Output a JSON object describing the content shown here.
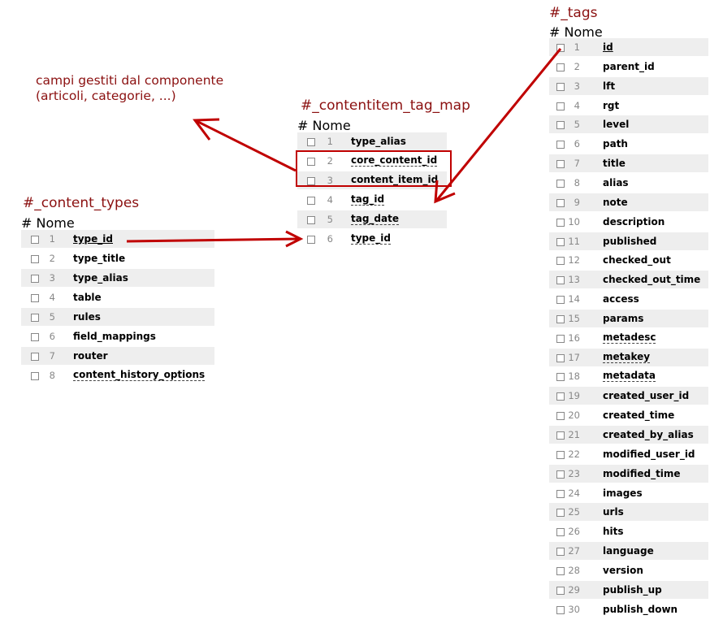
{
  "note": {
    "line1": "campi gestiti dal componente",
    "line2": "(articoli, categorie, ...)"
  },
  "tables": {
    "content_types": {
      "title": "#_content_types",
      "header_num": "#",
      "header_name": "Nome",
      "fields": [
        {
          "n": "1",
          "name": "type_id"
        },
        {
          "n": "2",
          "name": "type_title"
        },
        {
          "n": "3",
          "name": "type_alias"
        },
        {
          "n": "4",
          "name": "table"
        },
        {
          "n": "5",
          "name": "rules"
        },
        {
          "n": "6",
          "name": "field_mappings"
        },
        {
          "n": "7",
          "name": "router"
        },
        {
          "n": "8",
          "name": "content_history_options"
        }
      ]
    },
    "contentitem_tag_map": {
      "title": "#_contentitem_tag_map",
      "header_num": "#",
      "header_name": "Nome",
      "fields": [
        {
          "n": "1",
          "name": "type_alias"
        },
        {
          "n": "2",
          "name": "core_content_id"
        },
        {
          "n": "3",
          "name": "content_item_id"
        },
        {
          "n": "4",
          "name": "tag_id"
        },
        {
          "n": "5",
          "name": "tag_date"
        },
        {
          "n": "6",
          "name": "type_id"
        }
      ]
    },
    "tags": {
      "title": "#_tags",
      "header_num": "#",
      "header_name": "Nome",
      "fields": [
        {
          "n": "1",
          "name": "id"
        },
        {
          "n": "2",
          "name": "parent_id"
        },
        {
          "n": "3",
          "name": "lft"
        },
        {
          "n": "4",
          "name": "rgt"
        },
        {
          "n": "5",
          "name": "level"
        },
        {
          "n": "6",
          "name": "path"
        },
        {
          "n": "7",
          "name": "title"
        },
        {
          "n": "8",
          "name": "alias"
        },
        {
          "n": "9",
          "name": "note"
        },
        {
          "n": "10",
          "name": "description"
        },
        {
          "n": "11",
          "name": "published"
        },
        {
          "n": "12",
          "name": "checked_out"
        },
        {
          "n": "13",
          "name": "checked_out_time"
        },
        {
          "n": "14",
          "name": "access"
        },
        {
          "n": "15",
          "name": "params"
        },
        {
          "n": "16",
          "name": "metadesc"
        },
        {
          "n": "17",
          "name": "metakey"
        },
        {
          "n": "18",
          "name": "metadata"
        },
        {
          "n": "19",
          "name": "created_user_id"
        },
        {
          "n": "20",
          "name": "created_time"
        },
        {
          "n": "21",
          "name": "created_by_alias"
        },
        {
          "n": "22",
          "name": "modified_user_id"
        },
        {
          "n": "23",
          "name": "modified_time"
        },
        {
          "n": "24",
          "name": "images"
        },
        {
          "n": "25",
          "name": "urls"
        },
        {
          "n": "26",
          "name": "hits"
        },
        {
          "n": "27",
          "name": "language"
        },
        {
          "n": "28",
          "name": "version"
        },
        {
          "n": "29",
          "name": "publish_up"
        },
        {
          "n": "30",
          "name": "publish_down"
        }
      ]
    }
  },
  "colors": {
    "title": "#8b1010",
    "arrow": "#c00000",
    "row_alt": "#eeeeee"
  }
}
